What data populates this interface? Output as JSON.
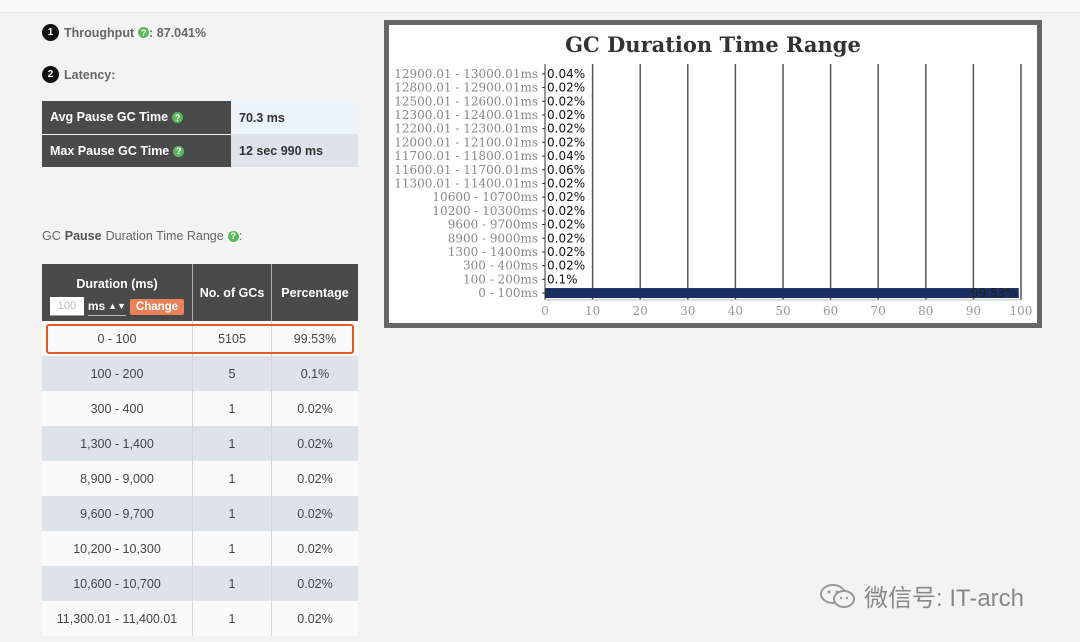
{
  "metrics": {
    "throughput": {
      "num": "1",
      "label": "Throughput",
      "value": " : 87.041%"
    },
    "latency": {
      "num": "2",
      "label": "Latency:"
    }
  },
  "pause_stats": [
    {
      "label": "Avg Pause GC Time",
      "value": "70.3 ms"
    },
    {
      "label": "Max Pause GC Time",
      "value": "12 sec 990 ms"
    }
  ],
  "range_section": {
    "prefix": "GC",
    "bold": "Pause",
    "suffix": "Duration Time Range"
  },
  "duration_table": {
    "col_duration": "Duration (ms)",
    "unit_input_placeholder": "100",
    "unit_select": "ms",
    "change_button": "Change",
    "col_count": "No. of GCs",
    "col_percentage": "Percentage",
    "rows": [
      {
        "range": "0 - 100",
        "count": "5105",
        "percentage": "99.53%"
      },
      {
        "range": "100 - 200",
        "count": "5",
        "percentage": "0.1%"
      },
      {
        "range": "300 - 400",
        "count": "1",
        "percentage": "0.02%"
      },
      {
        "range": "1,300 - 1,400",
        "count": "1",
        "percentage": "0.02%"
      },
      {
        "range": "8,900 - 9,000",
        "count": "1",
        "percentage": "0.02%"
      },
      {
        "range": "9,600 - 9,700",
        "count": "1",
        "percentage": "0.02%"
      },
      {
        "range": "10,200 - 10,300",
        "count": "1",
        "percentage": "0.02%"
      },
      {
        "range": "10,600 - 10,700",
        "count": "1",
        "percentage": "0.02%"
      },
      {
        "range": "11,300.01 - 11,400.01",
        "count": "1",
        "percentage": "0.02%"
      }
    ]
  },
  "chart_data": {
    "type": "bar",
    "orientation": "horizontal",
    "title": "GC Duration Time Range",
    "categories": [
      "12900.01 - 13000.01ms",
      "12800.01 - 12900.01ms",
      "12500.01 - 12600.01ms",
      "12300.01 - 12400.01ms",
      "12200.01 - 12300.01ms",
      "12000.01 - 12100.01ms",
      "11700.01 - 11800.01ms",
      "11600.01 - 11700.01ms",
      "11300.01 - 11400.01ms",
      "10600 - 10700ms",
      "10200 - 10300ms",
      "9600 - 9700ms",
      "8900 - 9000ms",
      "1300 - 1400ms",
      "300 - 400ms",
      "100 - 200ms",
      "0 - 100ms"
    ],
    "values": [
      0.04,
      0.02,
      0.02,
      0.02,
      0.02,
      0.02,
      0.04,
      0.06,
      0.02,
      0.02,
      0.02,
      0.02,
      0.02,
      0.02,
      0.02,
      0.1,
      99.53
    ],
    "value_labels": [
      "0.04%",
      "0.02%",
      "0.02%",
      "0.02%",
      "0.02%",
      "0.02%",
      "0.04%",
      "0.06%",
      "0.02%",
      "0.02%",
      "0.02%",
      "0.02%",
      "0.02%",
      "0.02%",
      "0.02%",
      "0.1%",
      "99.53%"
    ],
    "xlim": [
      0,
      100
    ],
    "xticks": [
      0,
      10,
      20,
      30,
      40,
      50,
      60,
      70,
      80,
      90,
      100
    ],
    "grid": true,
    "bar_color": "#1c2f63"
  },
  "watermark": "微信号: IT-arch"
}
